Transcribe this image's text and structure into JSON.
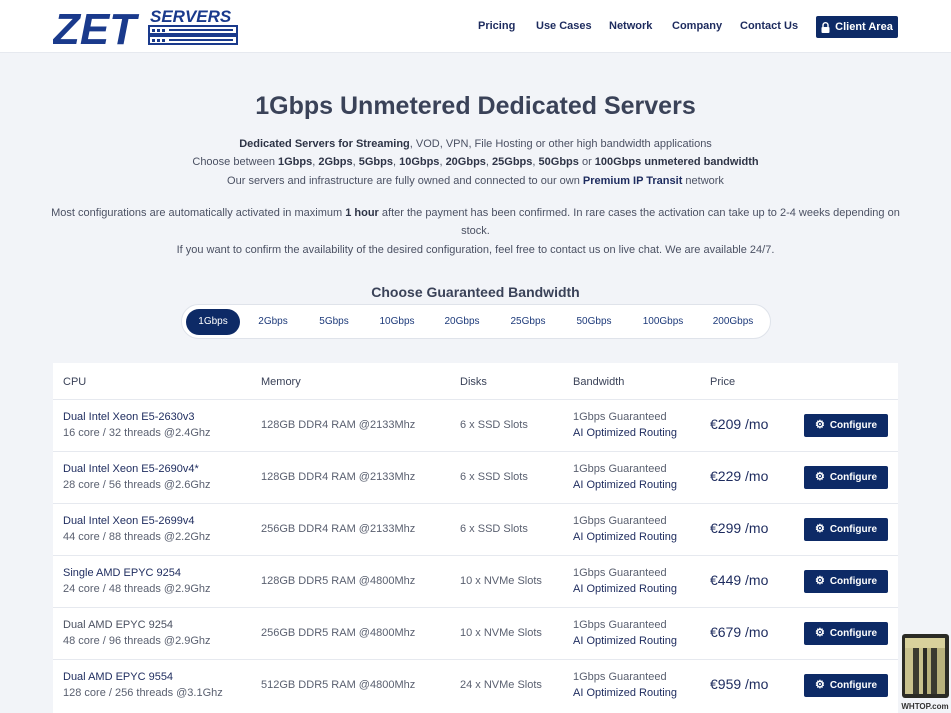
{
  "header": {
    "logo_letters": "ZET",
    "logo_servers": "SERVERS",
    "nav": [
      {
        "label": "Pricing"
      },
      {
        "label": "Use Cases"
      },
      {
        "label": "Network"
      },
      {
        "label": "Company"
      },
      {
        "label": "Contact Us"
      }
    ],
    "client_area_label": "Client Area"
  },
  "hero": {
    "title": "1Gbps Unmetered Dedicated Servers",
    "line1": {
      "bold": "Dedicated Servers for Streaming",
      "rest": ", VOD, VPN, File Hosting or other high bandwidth applications"
    },
    "line2": {
      "prefix": "Choose between ",
      "items": [
        "1Gbps",
        "2Gbps",
        "5Gbps",
        "10Gbps",
        "20Gbps",
        "25Gbps",
        "50Gbps"
      ],
      "or": " or ",
      "last": "100Gbps unmetered bandwidth"
    },
    "line3": {
      "prefix": "Our servers and infrastructure are fully owned and connected to our own ",
      "link": "Premium IP Transit",
      "suffix": " network"
    },
    "line4": {
      "prefix": "Most configurations are automatically activated in maximum ",
      "bold": "1 hour",
      "suffix": " after the payment has been confirmed. In rare cases the activation can take up to 2-4 weeks depending on"
    },
    "line5": "stock.",
    "line6": "If you want to confirm the availability of the desired configuration, feel free to contact us on live chat. We are available 24/7."
  },
  "bandwidth": {
    "title": "Choose Guaranteed Bandwidth",
    "options": [
      "1Gbps",
      "2Gbps",
      "5Gbps",
      "10Gbps",
      "20Gbps",
      "25Gbps",
      "50Gbps",
      "100Gbps",
      "200Gbps"
    ],
    "selected": "1Gbps"
  },
  "table": {
    "headers": [
      "CPU",
      "Memory",
      "Disks",
      "Bandwidth",
      "Price"
    ],
    "configure_label": "Configure",
    "rows": [
      {
        "cpu": "Dual Intel Xeon E5-2630v3",
        "cores": "16 core / 32 threads @2.4Ghz",
        "memory": "128GB DDR4 RAM @2133Mhz",
        "disks": "6 x SSD Slots",
        "bw": "1Gbps Guaranteed",
        "routing": "AI Optimized Routing",
        "price": "€209 /mo"
      },
      {
        "cpu": "Dual Intel Xeon E5-2690v4*",
        "cores": "28 core / 56 threads @2.6Ghz",
        "memory": "128GB DDR4 RAM @2133Mhz",
        "disks": "6 x SSD Slots",
        "bw": "1Gbps Guaranteed",
        "routing": "AI Optimized Routing",
        "price": "€229 /mo"
      },
      {
        "cpu": "Dual Intel Xeon E5-2699v4",
        "cores": "44 core / 88 threads @2.2Ghz",
        "memory": "256GB DDR4 RAM @2133Mhz",
        "disks": "6 x SSD Slots",
        "bw": "1Gbps Guaranteed",
        "routing": "AI Optimized Routing",
        "price": "€299 /mo"
      },
      {
        "cpu": "Single AMD EPYC 9254",
        "cores": "24 core / 48 threads @2.9Ghz",
        "memory": "128GB DDR5 RAM @4800Mhz",
        "disks": "10 x NVMe Slots",
        "bw": "1Gbps Guaranteed",
        "routing": "AI Optimized Routing",
        "price": "€449 /mo"
      },
      {
        "cpu": "Dual AMD EPYC 9254",
        "cores": "48 core / 96 threads @2.9Ghz",
        "memory": "256GB DDR5 RAM @4800Mhz",
        "disks": "10 x NVMe Slots",
        "bw": "1Gbps Guaranteed",
        "routing": "AI Optimized Routing",
        "price": "€679 /mo"
      },
      {
        "cpu": "Dual AMD EPYC 9554",
        "cores": "128 core / 256 threads @3.1Ghz",
        "memory": "512GB DDR5 RAM @4800Mhz",
        "disks": "24 x NVMe Slots",
        "bw": "1Gbps Guaranteed",
        "routing": "AI Optimized Routing",
        "price": "€959 /mo"
      }
    ]
  },
  "watermark": {
    "text": "WHTOP.com"
  },
  "colors": {
    "brand": "#0d2a66",
    "link": "#1d2b5e",
    "background": "#f2f4f8"
  }
}
